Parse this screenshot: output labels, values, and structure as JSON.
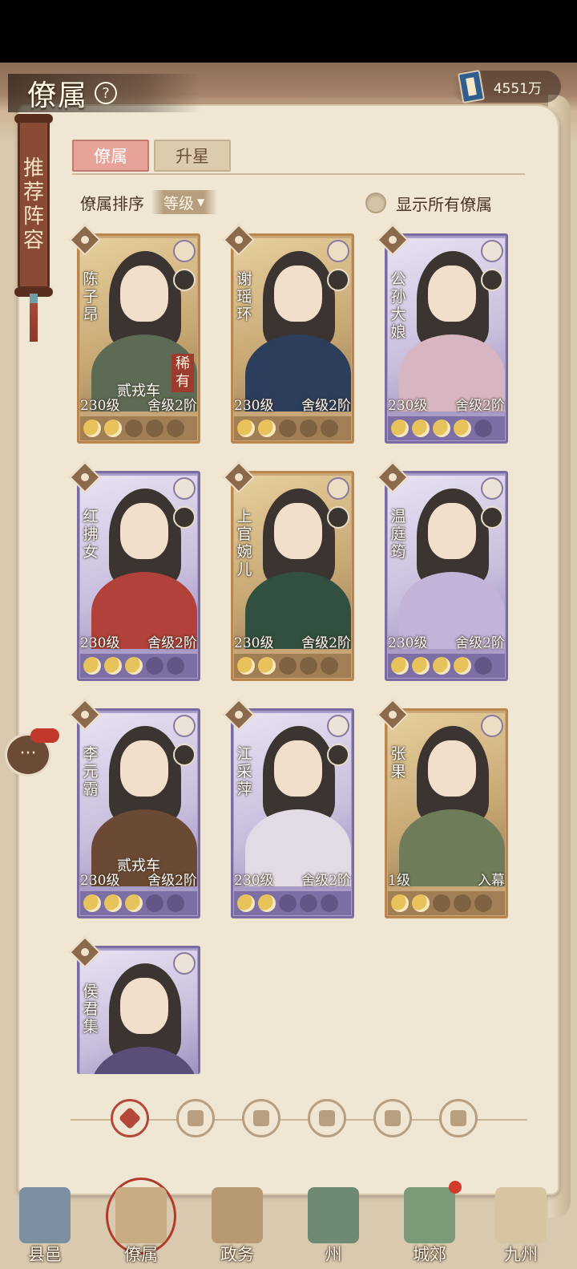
{
  "header": {
    "title": "僚属",
    "help_icon": "?",
    "currency_value": "4551万"
  },
  "side_banner": {
    "chars": [
      "推",
      "荐",
      "阵",
      "容"
    ]
  },
  "tabs": [
    {
      "label": "僚属",
      "active": true
    },
    {
      "label": "升星",
      "active": false
    }
  ],
  "sort": {
    "label": "僚属排序",
    "selected": "等级"
  },
  "show_all": {
    "label": "显示所有僚属",
    "checked": false
  },
  "cards": [
    {
      "name": "陈子昂",
      "frame": "gold",
      "subtitle": "贰戎车",
      "rare": "稀有",
      "level": "230级",
      "rank": "舍级2阶",
      "moons": [
        1,
        1,
        0,
        0,
        0
      ]
    },
    {
      "name": "谢瑶环",
      "frame": "gold",
      "subtitle": "",
      "rare": "",
      "level": "230级",
      "rank": "舍级2阶",
      "moons": [
        1,
        1,
        0,
        0,
        0
      ]
    },
    {
      "name": "公孙大娘",
      "frame": "purple",
      "subtitle": "",
      "rare": "",
      "level": "230级",
      "rank": "舍级2阶",
      "moons": [
        1,
        1,
        1,
        1,
        0
      ]
    },
    {
      "name": "红拂女",
      "frame": "purple",
      "subtitle": "",
      "rare": "",
      "level": "230级",
      "rank": "舍级2阶",
      "moons": [
        1,
        1,
        1,
        0,
        0
      ]
    },
    {
      "name": "上官婉儿",
      "frame": "gold",
      "subtitle": "",
      "rare": "",
      "level": "230级",
      "rank": "舍级2阶",
      "moons": [
        1,
        1,
        0,
        0,
        0
      ]
    },
    {
      "name": "温庭筠",
      "frame": "purple",
      "subtitle": "",
      "rare": "",
      "level": "230级",
      "rank": "舍级2阶",
      "moons": [
        1,
        1,
        1,
        1,
        0
      ]
    },
    {
      "name": "李元霸",
      "frame": "purple",
      "subtitle": "贰戎车",
      "rare": "",
      "level": "230级",
      "rank": "舍级2阶",
      "moons": [
        1,
        1,
        1,
        0,
        0
      ]
    },
    {
      "name": "江采萍",
      "frame": "purple",
      "subtitle": "",
      "rare": "",
      "level": "230级",
      "rank": "舍级2阶",
      "moons": [
        1,
        1,
        0,
        0,
        0
      ]
    },
    {
      "name": "张果",
      "frame": "gold",
      "subtitle": "",
      "rare": "",
      "level": "1级",
      "rank": "入幕",
      "moons": [
        1,
        1,
        0,
        0,
        0
      ]
    },
    {
      "name": "侯君集",
      "frame": "purple",
      "subtitle": "",
      "rare": "",
      "level": "",
      "rank": "",
      "moons": []
    }
  ],
  "filters": [
    "all-icon",
    "helmet-icon",
    "horse-icon",
    "fan-icon",
    "lion-icon",
    "leaf-icon"
  ],
  "nav": [
    {
      "label": "县邑",
      "active": false
    },
    {
      "label": "僚属",
      "active": true
    },
    {
      "label": "政务",
      "active": false
    },
    {
      "label": "州",
      "active": false
    },
    {
      "label": "城郊",
      "active": false
    },
    {
      "label": "九州",
      "active": false
    }
  ],
  "colors": {
    "paper": "#efe6d4",
    "tab_active": "#e7a39a",
    "gold_frame": "#b8864e",
    "purple_frame": "#7a6ca3",
    "accent_red": "#b4493a"
  }
}
